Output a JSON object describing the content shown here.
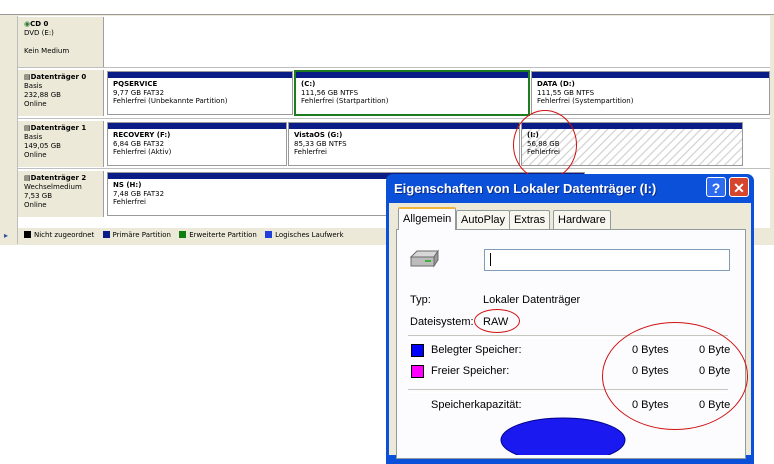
{
  "disk_management": {
    "cd": {
      "name": "CD 0",
      "line1": "DVD (E:)",
      "line2": "",
      "line3": "Kein Medium"
    },
    "disks": [
      {
        "name": "Datenträger 0",
        "type": "Basis",
        "size": "232,88 GB",
        "status": "Online",
        "partitions": [
          {
            "name": "PQSERVICE",
            "size": "9,77 GB FAT32",
            "status": "Fehlerfrei (Unbekannte Partition)"
          },
          {
            "name": "(C:)",
            "size": "111,56 GB NTFS",
            "status": "Fehlerfrei (Startpartition)"
          },
          {
            "name": "DATA  (D:)",
            "size": "111,55 GB NTFS",
            "status": "Fehlerfrei (Systempartition)"
          }
        ]
      },
      {
        "name": "Datenträger 1",
        "type": "Basis",
        "size": "149,05 GB",
        "status": "Online",
        "partitions": [
          {
            "name": "RECOVERY  (F:)",
            "size": "6,84 GB FAT32",
            "status": "Fehlerfrei (Aktiv)"
          },
          {
            "name": "VistaOS  (G:)",
            "size": "85,33 GB NTFS",
            "status": "Fehlerfrei"
          },
          {
            "name": "(I:)",
            "size": "56,88 GB",
            "status": "Fehlerfrei"
          }
        ]
      },
      {
        "name": "Datenträger 2",
        "type": "Wechselmedium",
        "size": "7,53 GB",
        "status": "Online",
        "partitions": [
          {
            "name": "NS  (H:)",
            "size": "7,48 GB FAT32",
            "status": "Fehlerfrei"
          }
        ]
      }
    ],
    "legend": [
      {
        "label": "Nicht zugeordnet",
        "color": "#000000"
      },
      {
        "label": "Primäre Partition",
        "color": "#0a1d87"
      },
      {
        "label": "Erweiterte Partition",
        "color": "#0f7d0f"
      },
      {
        "label": "Logisches Laufwerk",
        "color": "#1f3fd8"
      }
    ]
  },
  "dialog": {
    "title": "Eigenschaften von Lokaler Datenträger (I:)",
    "help": "?",
    "close": "✕",
    "tabs": [
      "Allgemein",
      "AutoPlay",
      "Extras",
      "Hardware"
    ],
    "active_tab": "Allgemein",
    "name_value": "",
    "type_label": "Typ:",
    "type_value": "Lokaler Datenträger",
    "fs_label": "Dateisystem:",
    "fs_value": "RAW",
    "used_label": "Belegter Speicher:",
    "used_bytes": "0 Bytes",
    "used_size": "0 Byte",
    "free_label": "Freier Speicher:",
    "free_bytes": "0 Bytes",
    "free_size": "0 Byte",
    "capacity_label": "Speicherkapazität:",
    "capacity_bytes": "0 Bytes",
    "capacity_size": "0 Byte",
    "colors": {
      "used": "#0000ff",
      "free": "#ff00ff"
    }
  }
}
